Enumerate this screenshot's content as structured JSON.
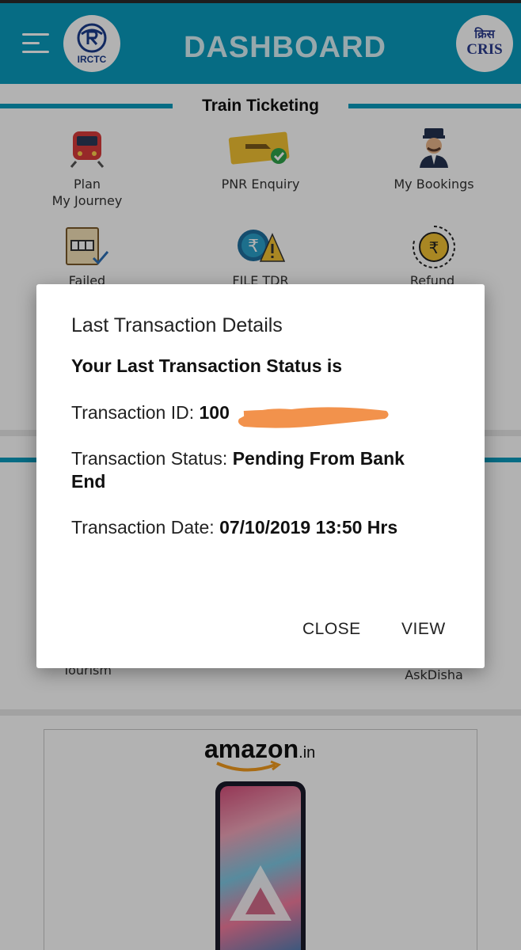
{
  "header": {
    "title": "DASHBOARD",
    "left_logo_text": "IRCTC",
    "right_logo_hindi": "क्रिस",
    "right_logo_text": "CRIS"
  },
  "train_ticketing": {
    "section_title": "Train Ticketing",
    "items": [
      {
        "label": "Plan\nMy Journey",
        "icon": "train-icon"
      },
      {
        "label": "PNR Enquiry",
        "icon": "ticket-check-icon"
      },
      {
        "label": "My Bookings",
        "icon": "ticket-collector-icon"
      },
      {
        "label": "Failed",
        "icon": "failed-transaction-icon"
      },
      {
        "label": "FILE TDR",
        "icon": "rupee-warning-icon"
      },
      {
        "label": "Refund",
        "icon": "refund-rupee-icon"
      }
    ]
  },
  "other_services": {
    "items": [
      {
        "label": "Tourism"
      },
      {
        "label": "AskDisha"
      }
    ]
  },
  "advertisement": {
    "brand": "amazon",
    "brand_tld": ".in"
  },
  "dialog": {
    "title": "Last Transaction Details",
    "subtitle": "Your Last Transaction Status is",
    "transaction_id_label": "Transaction ID: ",
    "transaction_id_value": "100",
    "transaction_status_label": "Transaction Status: ",
    "transaction_status_value": "Pending From Bank End",
    "transaction_date_label": "Transaction Date: ",
    "transaction_date_value": "07/10/2019 13:50 Hrs",
    "close_button": "CLOSE",
    "view_button": "VIEW"
  },
  "colors": {
    "primary": "#0a9bbd",
    "redaction": "#f2924c"
  }
}
